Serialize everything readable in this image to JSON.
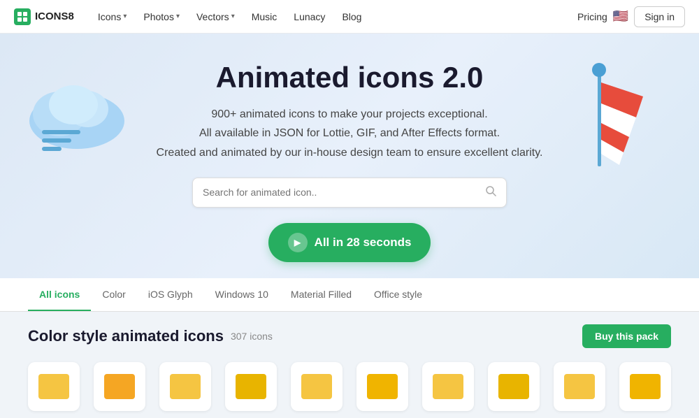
{
  "logo": {
    "text": "ICONS8"
  },
  "nav": {
    "links": [
      {
        "label": "Icons",
        "hasDropdown": true
      },
      {
        "label": "Photos",
        "hasDropdown": true
      },
      {
        "label": "Vectors",
        "hasDropdown": true
      },
      {
        "label": "Music",
        "hasDropdown": false
      },
      {
        "label": "Lunacy",
        "hasDropdown": false
      },
      {
        "label": "Blog",
        "hasDropdown": false
      }
    ],
    "pricing": "Pricing",
    "signin": "Sign in"
  },
  "hero": {
    "title": "Animated icons 2.0",
    "lines": [
      "900+ animated icons to make your projects exceptional.",
      "All available in JSON for Lottie, GIF, and After Effects format.",
      "Created and animated by our in-house design team to ensure excellent clarity."
    ],
    "search_placeholder": "Search for animated icon..",
    "cta": "All in 28 seconds"
  },
  "tabs": [
    {
      "label": "All icons",
      "active": true
    },
    {
      "label": "Color",
      "active": false
    },
    {
      "label": "iOS Glyph",
      "active": false
    },
    {
      "label": "Windows 10",
      "active": false
    },
    {
      "label": "Material Filled",
      "active": false
    },
    {
      "label": "Office style",
      "active": false
    }
  ],
  "section": {
    "title": "Color style animated icons",
    "count": "307 icons",
    "buy_label": "Buy this pack"
  }
}
